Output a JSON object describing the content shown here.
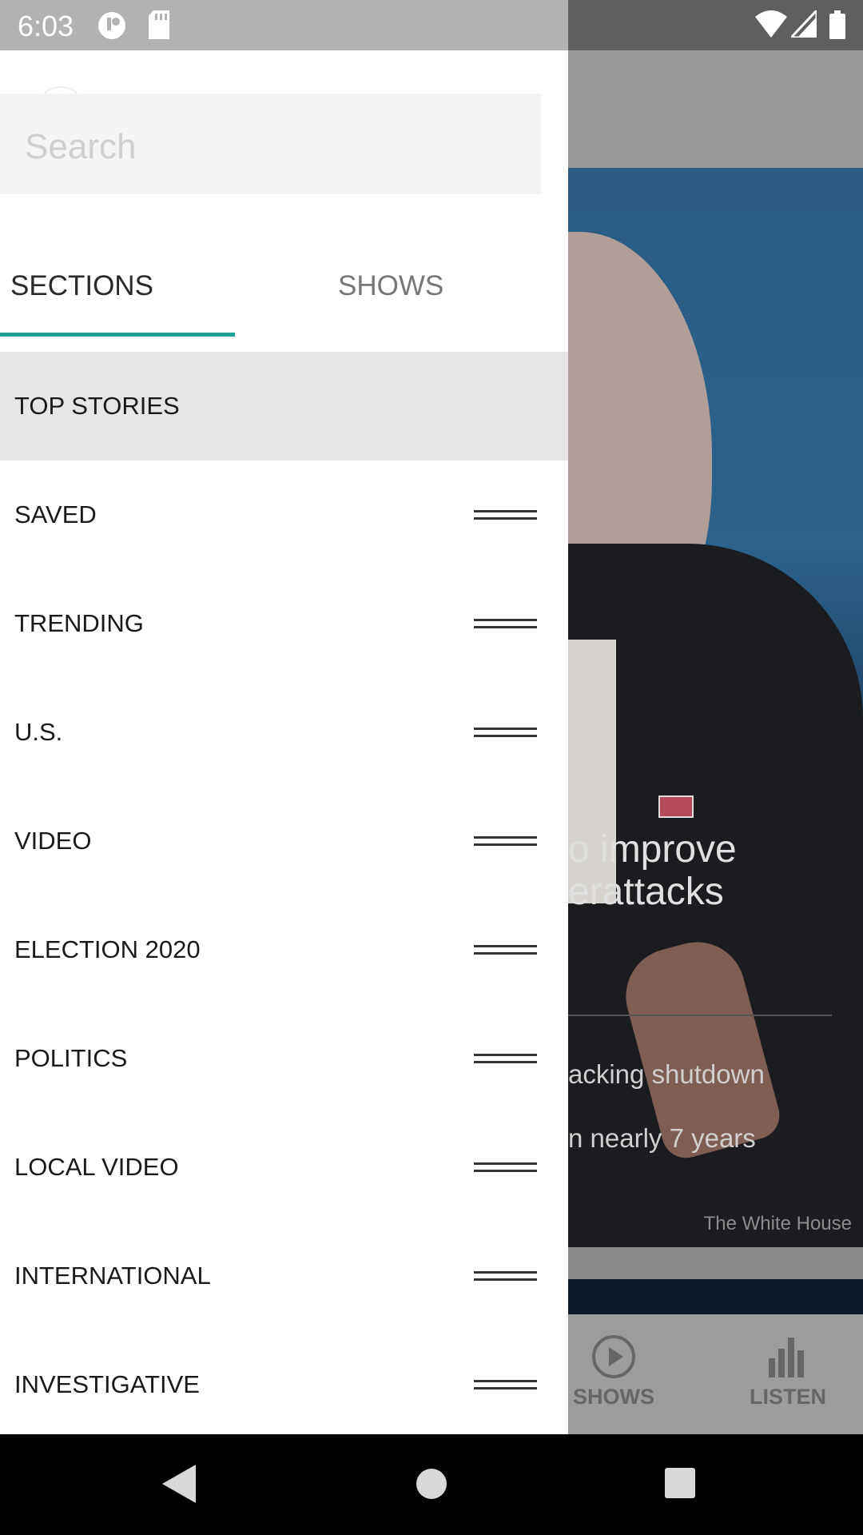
{
  "status_bar": {
    "time": "6:03",
    "left_icons": [
      "app-notification-icon",
      "sd-card-icon"
    ],
    "right_icons": [
      "wifi-icon",
      "cell-signal-icon",
      "battery-icon"
    ]
  },
  "drawer": {
    "search": {
      "placeholder": "Search",
      "value": ""
    },
    "tabs": [
      {
        "label": "SECTIONS",
        "selected": true
      },
      {
        "label": "SHOWS",
        "selected": false
      }
    ],
    "sections": [
      {
        "label": "TOP STORIES",
        "selected": true,
        "reorderable": false
      },
      {
        "label": "SAVED",
        "reorderable": true
      },
      {
        "label": "TRENDING",
        "reorderable": true
      },
      {
        "label": "U.S.",
        "reorderable": true
      },
      {
        "label": "VIDEO",
        "reorderable": true
      },
      {
        "label": "ELECTION 2020",
        "reorderable": true
      },
      {
        "label": "POLITICS",
        "reorderable": true
      },
      {
        "label": "LOCAL VIDEO",
        "reorderable": true
      },
      {
        "label": "INTERNATIONAL",
        "reorderable": true
      },
      {
        "label": "INVESTIGATIVE",
        "reorderable": true
      }
    ],
    "accent_color": "#1e9e95"
  },
  "background": {
    "headline_line1": "o improve",
    "headline_line2": "erattacks",
    "link1": "acking shutdown",
    "link2": "n nearly 7 years",
    "credit": "The White House",
    "bottom_nav": [
      {
        "label": "SHOWS",
        "icon": "play-circle-icon"
      },
      {
        "label": "LISTEN",
        "icon": "equalizer-icon"
      }
    ]
  },
  "system_nav": [
    "back-icon",
    "home-icon",
    "recents-icon"
  ]
}
